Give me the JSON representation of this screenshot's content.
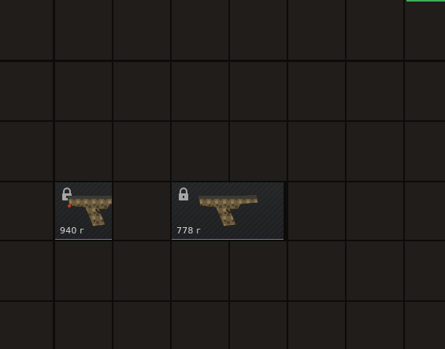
{
  "inventory": {
    "items": [
      {
        "name": "pistol",
        "price": "940 г",
        "locked": true,
        "rarity_color": "#9d5bb0",
        "icon": "pistol-icon",
        "lock_icon": "lock-icon"
      },
      {
        "name": "pistol",
        "price": "778 г",
        "locked": true,
        "rarity_color": "#9d5bb0",
        "icon": "pistol-icon",
        "lock_icon": "lock-icon"
      }
    ],
    "colors": {
      "cell": "#201d1a",
      "gap": "#0d0c0a",
      "accent": "#3fae5a"
    }
  }
}
